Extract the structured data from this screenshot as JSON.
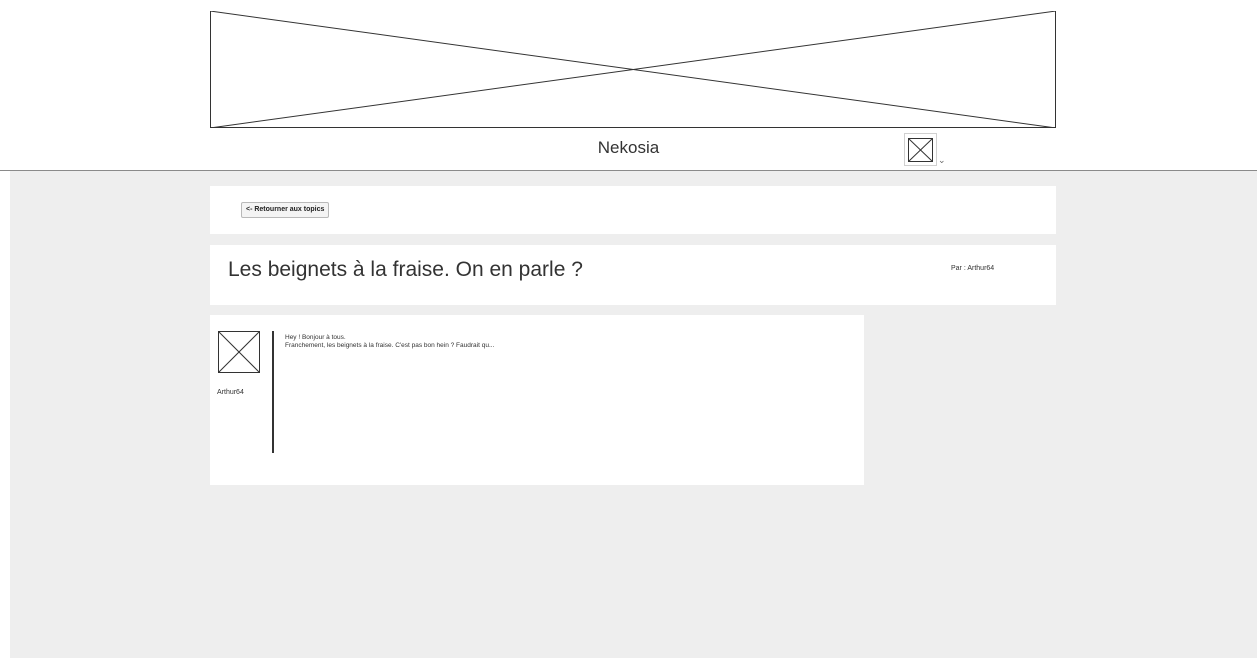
{
  "header": {
    "banner_icon": "image-placeholder-icon",
    "site_title": "Nekosia",
    "user_menu": {
      "avatar_icon": "image-placeholder-icon",
      "chevron_icon": "chevron-down-icon",
      "chevron": "⌄"
    }
  },
  "colors": {
    "page_background": "#eeeeee",
    "panel_background": "#ffffff",
    "divider": "#8a8a8a"
  },
  "navigation": {
    "back_label": "<- Retourner aux topics"
  },
  "topic": {
    "title": "Les beignets à la fraise. On en parle ?",
    "author_label": "Par : Arthur64"
  },
  "posts": [
    {
      "author": "Arthur64",
      "avatar_icon": "image-placeholder-icon",
      "lines": [
        "Hey ! Bonjour à tous.",
        "Franchement, les beignets à la fraise. C'est pas bon hein ? Faudrait qu..."
      ]
    }
  ]
}
